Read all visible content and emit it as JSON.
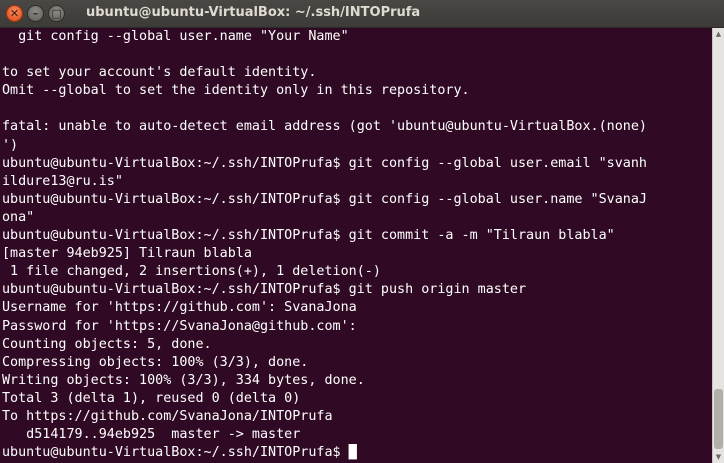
{
  "window": {
    "title": "ubuntu@ubuntu-VirtualBox: ~/.ssh/INTOPrufa",
    "controls": {
      "close": "✕",
      "minimize": "–",
      "maximize": "□"
    }
  },
  "terminal": {
    "lines": [
      "  git config --global user.name \"Your Name\"",
      "",
      "to set your account's default identity.",
      "Omit --global to set the identity only in this repository.",
      "",
      "fatal: unable to auto-detect email address (got 'ubuntu@ubuntu-VirtualBox.(none)",
      "')",
      "ubuntu@ubuntu-VirtualBox:~/.ssh/INTOPrufa$ git config --global user.email \"svanh",
      "ildure13@ru.is\"",
      "ubuntu@ubuntu-VirtualBox:~/.ssh/INTOPrufa$ git config --global user.name \"SvanaJ",
      "ona\"",
      "ubuntu@ubuntu-VirtualBox:~/.ssh/INTOPrufa$ git commit -a -m \"Tilraun blabla\"",
      "[master 94eb925] Tilraun blabla",
      " 1 file changed, 2 insertions(+), 1 deletion(-)",
      "ubuntu@ubuntu-VirtualBox:~/.ssh/INTOPrufa$ git push origin master",
      "Username for 'https://github.com': SvanaJona",
      "Password for 'https://SvanaJona@github.com':",
      "Counting objects: 5, done.",
      "Compressing objects: 100% (3/3), done.",
      "Writing objects: 100% (3/3), 334 bytes, done.",
      "Total 3 (delta 1), reused 0 (delta 0)",
      "To https://github.com/SvanaJona/INTOPrufa",
      "   d514179..94eb925  master -> master",
      "ubuntu@ubuntu-VirtualBox:~/.ssh/INTOPrufa$ "
    ],
    "cursor": "█"
  },
  "scrollbar": {
    "up_arrow": "▲",
    "down_arrow": "▼"
  },
  "colors": {
    "terminal_background": "#300a24",
    "terminal_text": "#ffffff",
    "titlebar": "#3c3b37",
    "close_button": "#df4a16"
  }
}
